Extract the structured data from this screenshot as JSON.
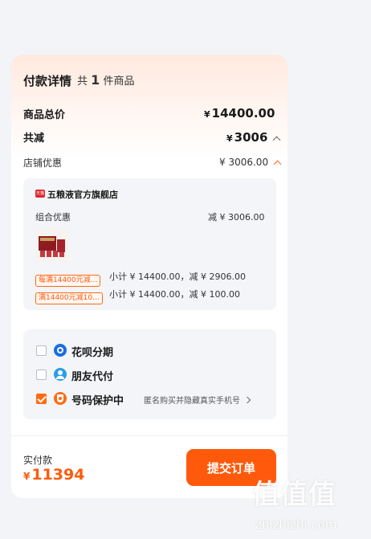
{
  "header": {
    "title": "付款详情",
    "count_prefix": "共",
    "count_value": "1",
    "count_suffix": "件商品"
  },
  "summary": {
    "goods_total_label": "商品总价",
    "goods_total_currency": "¥",
    "goods_total_value": "14400.00",
    "discount_label": "共减",
    "discount_currency": "¥",
    "discount_value": "3006",
    "shop_discount_label": "店铺优惠",
    "shop_discount_value": "¥ 3006.00"
  },
  "shop": {
    "badge": "天猫",
    "name": "五粮液官方旗舰店",
    "combo_label": "组合优惠",
    "combo_value": "减 ¥ 3006.00",
    "promos": [
      {
        "tag": "每满14400元减...",
        "detail": "小计 ¥ 14400.00，减 ¥ 2906.00"
      },
      {
        "tag": "满14400元减10...",
        "detail": "小计 ¥ 14400.00，减 ¥ 100.00"
      }
    ]
  },
  "payment_options": [
    {
      "label": "花呗分期",
      "checked": false,
      "icon": "huabei-icon"
    },
    {
      "label": "朋友代付",
      "checked": false,
      "icon": "friend-pay-icon"
    },
    {
      "label": "号码保护中",
      "checked": true,
      "icon": "shield-icon",
      "extra": "匿名购买并隐藏真实手机号"
    }
  ],
  "footer": {
    "paid_label": "实付款",
    "paid_currency": "¥",
    "paid_value": "11394",
    "submit_label": "提交订单"
  },
  "watermark": {
    "text": "值值值",
    "url": "zhizhizhi.com"
  },
  "colors": {
    "accent": "#ff5a0c",
    "card_bg": "#f3f5f8",
    "page_bg": "#f3f4f7"
  }
}
